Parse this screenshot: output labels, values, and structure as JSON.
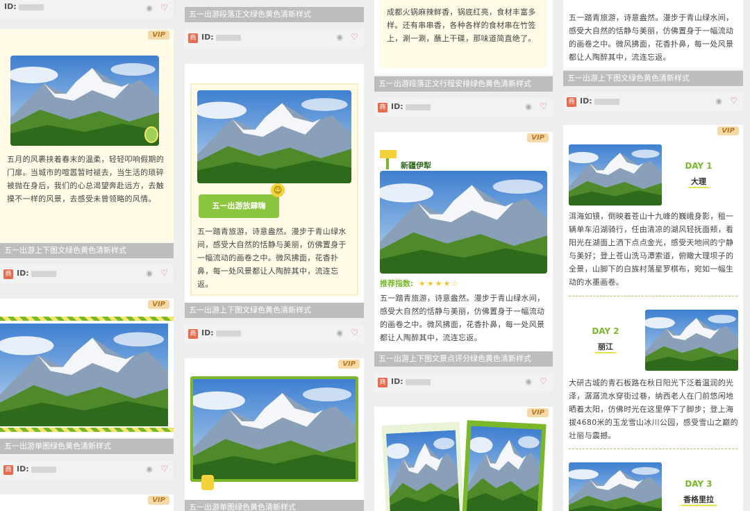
{
  "vip_label": "VIP",
  "id_prefix": "ID:",
  "logo_char": "商",
  "icons": {
    "eye": "eye-icon",
    "heart": "heart-icon"
  },
  "colors": {
    "green": "#7ab82a",
    "yellow": "#f4e86b",
    "vip_bg": "#f6d9a8",
    "strip": "#bdbdbd"
  },
  "col1": {
    "card1_text": "五月的风裹挟着春末的温柔，轻轻叩响假期的门扉。当城市的喧嚣暂时褪去，当生活的琐碎被抛在身后，我们的心总渴望奔赴远方，去触摸不一样的风景，去感受未曾领略的风情。",
    "card1_title": "五一出游上下图文绿色黄色清新样式",
    "card2_title": "五一出游单图绿色黄色清新样式"
  },
  "col2": {
    "card0_title": "五一出游段落正文绿色黄色清新样式",
    "card1_banner": "五一出游放肆嗨",
    "card1_text": "五一踏青旅游，诗意盎然。漫步于青山绿水间，感受大自然的恬静与美丽，仿佛置身于一幅流动的画卷之中。微风拂面，花香扑鼻，每一处风景都让人陶醉其中，流连忘返。",
    "card1_title": "五一出游上下图文绿色黄色清新样式",
    "card2_title": "五一出游单图绿色黄色清新样式"
  },
  "col3": {
    "card0_text": "成都火锅麻辣鲜香，锅底红亮，食材丰富多样。还有串串香，各种各样的食材串在竹签上，涮一涮，蘸上干碟，那味道简直绝了。",
    "card0_title": "五一出游段落正文行程安排绿色黄色清新样式",
    "card1_place": "新疆伊犁",
    "card1_rating_label": "推荐指数:",
    "card1_text": "五一踏青旅游，诗意盎然。漫步于青山绿水间，感受大自然的恬静与美丽，仿佛置身于一幅流动的画卷之中。微风拂面，花香扑鼻，每一处风景都让人陶醉其中，流连忘返。",
    "card1_title": "五一出游上下图文景点评分绿色黄色清新样式",
    "card1_rating": 4
  },
  "col4": {
    "card0_text": "五一踏青旅游，诗意盎然。漫步于青山绿水间，感受大自然的恬静与美丽，仿佛置身于一幅流动的画卷之中。微风拂面，花香扑鼻，每一处风景都让人陶醉其中，流连忘返。",
    "card0_title": "五一出游上下图文绿色黄色清新样式",
    "day1": "DAY 1",
    "city1": "大理",
    "text1": "洱海如镜，倒映着苍山十九峰的巍峨身影，租一辆单车沿湖骑行，任由清凉的湖风轻抚面颊，看阳光在湖面上洒下点点金光，感受天地间的宁静与美好；登上苍山洗马潭索道，俯瞰大理坝子的全景，山脚下的白族村落星罗棋布，宛如一幅生动的水墨画卷。",
    "day2": "DAY 2",
    "city2": "丽江",
    "text2": "大研古城的青石板路在秋日阳光下泛着温润的光泽，潺潺流水穿街过巷，纳西老人在门前悠闲地晒着太阳，仿佛时光在这里停下了脚步；登上海拔4680米的玉龙雪山冰川公园，感受雪山之巅的壮丽与震撼。",
    "day3": "DAY 3",
    "city3": "香格里拉"
  }
}
